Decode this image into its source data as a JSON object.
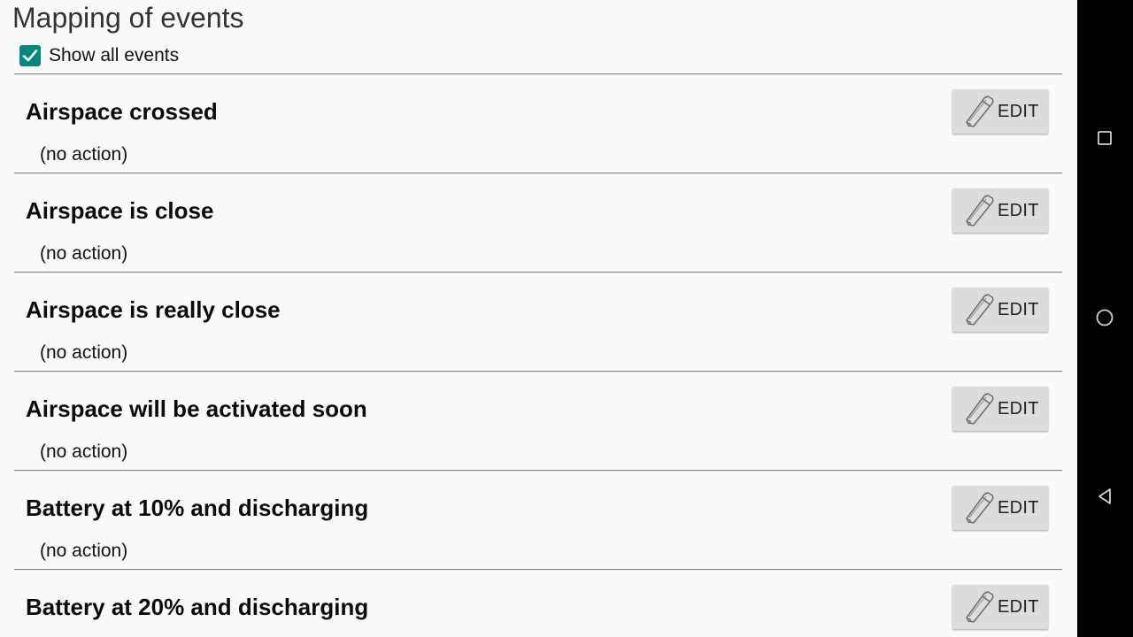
{
  "page": {
    "title": "Mapping of events"
  },
  "show_all": {
    "label": "Show all events",
    "checked": true,
    "color": "#00897b"
  },
  "events": [
    {
      "name": "Airspace crossed",
      "action": "(no action)",
      "edit_label": "EDIT"
    },
    {
      "name": "Airspace is close",
      "action": "(no action)",
      "edit_label": "EDIT"
    },
    {
      "name": "Airspace is really close",
      "action": "(no action)",
      "edit_label": "EDIT"
    },
    {
      "name": "Airspace will be activated soon",
      "action": "(no action)",
      "edit_label": "EDIT"
    },
    {
      "name": "Battery at 10% and discharging",
      "action": "(no action)",
      "edit_label": "EDIT"
    },
    {
      "name": "Battery at 20% and discharging",
      "action": "",
      "edit_label": "EDIT"
    }
  ],
  "navbar": {
    "buttons": [
      {
        "icon": "recents-square-icon"
      },
      {
        "icon": "home-circle-icon"
      },
      {
        "icon": "back-triangle-icon"
      }
    ]
  }
}
